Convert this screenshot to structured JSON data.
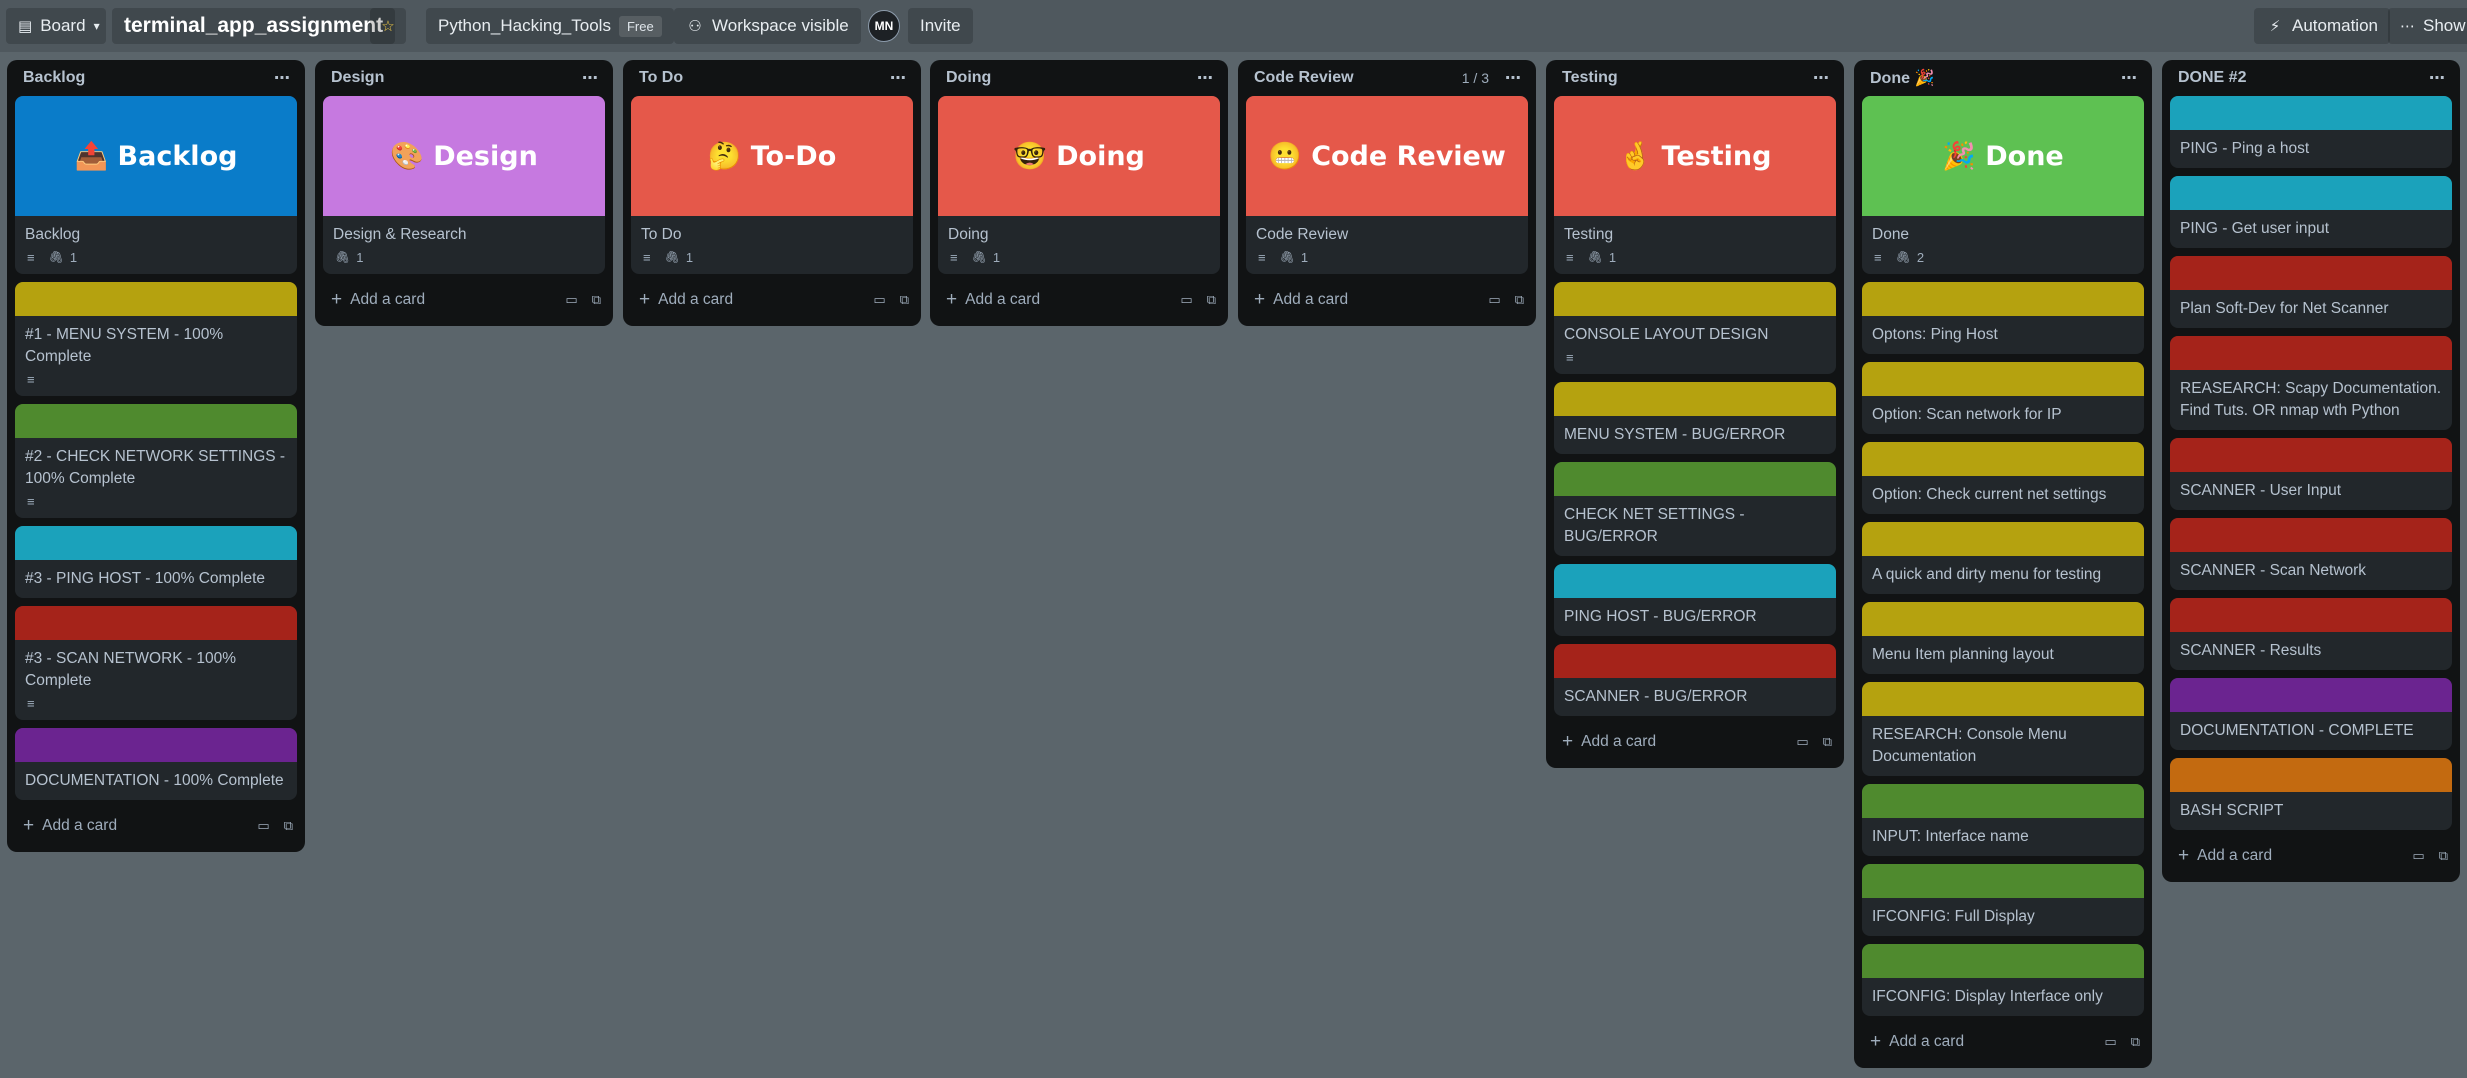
{
  "topbar": {
    "view_label": "Board",
    "board_title": "terminal_app_assignment",
    "workspace_name": "Python_Hacking_Tools",
    "plan_badge": "Free",
    "visibility_label": "Workspace visible",
    "avatar_initials": "MN",
    "invite_label": "Invite",
    "automation_label": "Automation",
    "show_menu_label": "Show m"
  },
  "colors": {
    "yellow": "#b5a20f",
    "green": "#4f8a2e",
    "cyan": "#1ba2bb",
    "red": "#a5231a",
    "purple": "#6b2490",
    "orange": "#c36a10",
    "blue": "#0a7cc9",
    "pink": "#c679e0",
    "coral": "#e5584a",
    "lime": "#5ec152"
  },
  "add_card_label": "Add a card",
  "lists": [
    {
      "title": "Backlog",
      "cards": [
        {
          "cover_text": "📤 Backlog",
          "cover_color": "#0a7cc9",
          "title": "Backlog",
          "desc": true,
          "attachments": "1"
        },
        {
          "strip_color": "#b5a20f",
          "title": "#1 - MENU SYSTEM - 100% Complete",
          "desc": true
        },
        {
          "strip_color": "#4f8a2e",
          "title": "#2 - CHECK NETWORK SETTINGS - 100% Complete",
          "desc": true
        },
        {
          "strip_color": "#1ba2bb",
          "title": "#3 - PING HOST - 100% Complete"
        },
        {
          "strip_color": "#a5231a",
          "title": "#3 - SCAN NETWORK - 100% Complete",
          "desc": true
        },
        {
          "strip_color": "#6b2490",
          "title": "DOCUMENTATION - 100% Complete"
        }
      ]
    },
    {
      "title": "Design",
      "cards": [
        {
          "cover_text": "🎨 Design",
          "cover_color": "#c679e0",
          "title": "Design & Research",
          "attachments": "1"
        }
      ]
    },
    {
      "title": "To Do",
      "cards": [
        {
          "cover_text": "🤔 To-Do",
          "cover_color": "#e5584a",
          "title": "To Do",
          "desc": true,
          "attachments": "1"
        }
      ]
    },
    {
      "title": "Doing",
      "cards": [
        {
          "cover_text": "🤓 Doing",
          "cover_color": "#e5584a",
          "title": "Doing",
          "desc": true,
          "attachments": "1"
        }
      ]
    },
    {
      "title": "Code Review",
      "count": "1 / 3",
      "cards": [
        {
          "cover_text": "😬 Code Review",
          "cover_color": "#e5584a",
          "title": "Code Review",
          "desc": true,
          "attachments": "1"
        }
      ]
    },
    {
      "title": "Testing",
      "cards": [
        {
          "cover_text": "🤞 Testing",
          "cover_color": "#e5584a",
          "title": "Testing",
          "desc": true,
          "attachments": "1"
        },
        {
          "strip_color": "#b5a20f",
          "title": "CONSOLE LAYOUT DESIGN",
          "desc": true
        },
        {
          "strip_color": "#b5a20f",
          "title": "MENU SYSTEM - BUG/ERROR"
        },
        {
          "strip_color": "#4f8a2e",
          "title": "CHECK NET SETTINGS - BUG/ERROR"
        },
        {
          "strip_color": "#1ba2bb",
          "title": "PING HOST - BUG/ERROR"
        },
        {
          "strip_color": "#a5231a",
          "title": "SCANNER - BUG/ERROR"
        }
      ]
    },
    {
      "title": "Done 🎉",
      "cards": [
        {
          "cover_text": "🎉 Done",
          "cover_color": "#5ec152",
          "title": "Done",
          "desc": true,
          "attachments": "2"
        },
        {
          "strip_color": "#b5a20f",
          "title": "Optons: Ping Host"
        },
        {
          "strip_color": "#b5a20f",
          "title": "Option: Scan network for IP"
        },
        {
          "strip_color": "#b5a20f",
          "title": "Option: Check current net settings"
        },
        {
          "strip_color": "#b5a20f",
          "title": "A quick and dirty menu for testing"
        },
        {
          "strip_color": "#b5a20f",
          "title": "Menu Item planning layout"
        },
        {
          "strip_color": "#b5a20f",
          "title": "RESEARCH: Console Menu Documentation"
        },
        {
          "strip_color": "#4f8a2e",
          "title": "INPUT: Interface name"
        },
        {
          "strip_color": "#4f8a2e",
          "title": "IFCONFIG: Full Display"
        },
        {
          "strip_color": "#4f8a2e",
          "title": "IFCONFIG: Display Interface only"
        }
      ]
    },
    {
      "title": "DONE #2",
      "cards": [
        {
          "strip_color": "#1ba2bb",
          "title": "PING - Ping a host"
        },
        {
          "strip_color": "#1ba2bb",
          "title": "PING - Get user input"
        },
        {
          "strip_color": "#a5231a",
          "title": "Plan Soft-Dev for Net Scanner"
        },
        {
          "strip_color": "#a5231a",
          "title": "REASEARCH: Scapy Documentation. Find Tuts. OR nmap wth Python"
        },
        {
          "strip_color": "#a5231a",
          "title": "SCANNER - User Input"
        },
        {
          "strip_color": "#a5231a",
          "title": "SCANNER - Scan Network"
        },
        {
          "strip_color": "#a5231a",
          "title": "SCANNER - Results"
        },
        {
          "strip_color": "#6b2490",
          "title": "DOCUMENTATION - COMPLETE"
        },
        {
          "strip_color": "#c36a10",
          "title": "BASH SCRIPT"
        }
      ]
    }
  ]
}
